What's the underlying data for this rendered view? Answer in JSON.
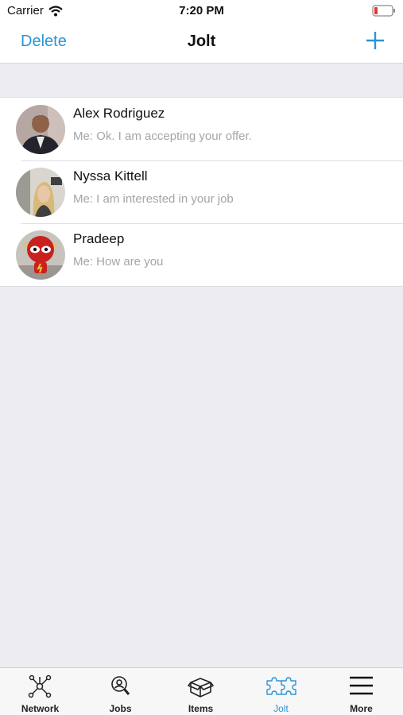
{
  "status_bar": {
    "carrier": "Carrier",
    "time": "7:20 PM"
  },
  "nav": {
    "left_action": "Delete",
    "title": "Jolt",
    "right_icon": "plus-icon"
  },
  "conversations": [
    {
      "name": "Alex Rodriguez",
      "preview": "Me: Ok. I am accepting your offer."
    },
    {
      "name": "Nyssa Kittell",
      "preview": "Me: I am interested in your job"
    },
    {
      "name": "Pradeep",
      "preview": "Me: How are you"
    }
  ],
  "tabs": [
    {
      "label": "Network",
      "icon": "network-icon"
    },
    {
      "label": "Jobs",
      "icon": "jobs-search-icon"
    },
    {
      "label": "Items",
      "icon": "box-icon"
    },
    {
      "label": "Jolt",
      "icon": "puzzle-icon",
      "active": true
    },
    {
      "label": "More",
      "icon": "menu-icon"
    }
  ],
  "colors": {
    "accent": "#2b95d6",
    "battery_low": "#e53935"
  }
}
